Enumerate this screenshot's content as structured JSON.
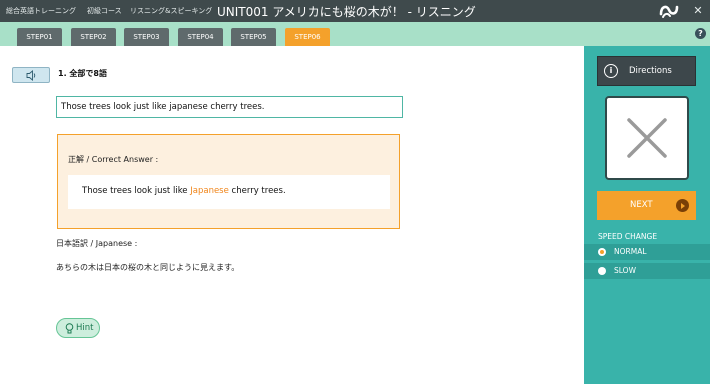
{
  "titlebar": {
    "crumbs": [
      "総合英語トレーニング",
      "初級コース",
      "リスニング&スピーキング"
    ],
    "unit_title": "UNIT001 アメリカにも桜の木が！ - リスニング",
    "close_label": "✕"
  },
  "steps": [
    "STEP01",
    "STEP02",
    "STEP03",
    "STEP04",
    "STEP05",
    "STEP06"
  ],
  "active_step": "STEP06",
  "help_label": "?",
  "question": {
    "title": "1. 全部で8語",
    "answer_value": "Those trees look just like japanese cherry trees."
  },
  "correct": {
    "label": "正解 / Correct Answer :",
    "before": "Those trees look just like ",
    "highlight": "Japanese",
    "after": " cherry trees."
  },
  "japanese": {
    "label": "日本語訳 / Japanese :",
    "text": "あちらの木は日本の桜の木と同じように見えます。"
  },
  "hint_label": "Hint",
  "sidebar": {
    "directions_label": "Directions",
    "info_glyph": "i",
    "result": "incorrect",
    "next_label": "NEXT",
    "speed_title": "SPEED CHANGE",
    "speeds": [
      "NORMAL",
      "SLOW"
    ],
    "selected_speed": "NORMAL"
  },
  "colors": {
    "accent_orange": "#f4a12b",
    "panel_teal": "#39b3aa",
    "titlebar": "#3f4a4c",
    "stepbar": "#a8e0c8"
  }
}
